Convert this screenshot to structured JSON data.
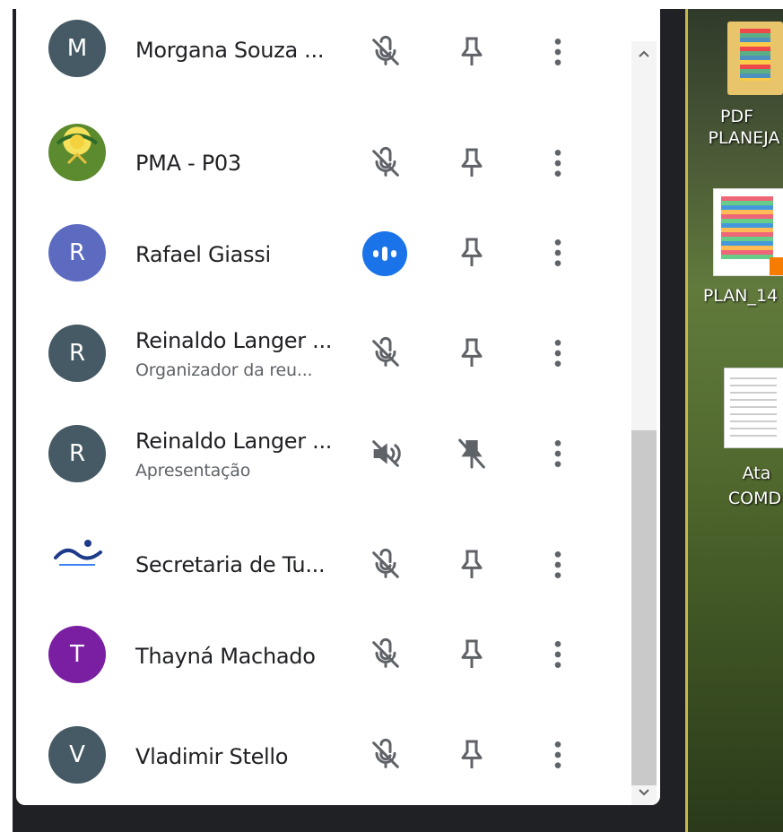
{
  "participants": [
    {
      "initial": "M",
      "name": "Morgana Souza ...",
      "subtitle": "",
      "avatar_color": "#455a64",
      "status": "muted"
    },
    {
      "initial": "",
      "name": "PMA - P03",
      "subtitle": "",
      "avatar_color": "#6f8f3a",
      "status": "muted"
    },
    {
      "initial": "R",
      "name": "Rafael Giassi",
      "subtitle": "",
      "avatar_color": "#5c6bc0",
      "status": "speaking"
    },
    {
      "initial": "R",
      "name": "Reinaldo Langer ...",
      "subtitle": "Organizador da reu...",
      "avatar_color": "#455a64",
      "status": "muted"
    },
    {
      "initial": "R",
      "name": "Reinaldo Langer ...",
      "subtitle": "Apresentação",
      "avatar_color": "#455a64",
      "status": "audio-off"
    },
    {
      "initial": "",
      "name": "Secretaria de Tu...",
      "subtitle": "",
      "avatar_color": "#ffffff",
      "status": "muted"
    },
    {
      "initial": "T",
      "name": "Thayná Machado",
      "subtitle": "",
      "avatar_color": "#7b1fa2",
      "status": "muted"
    },
    {
      "initial": "V",
      "name": "Vladimir Stello",
      "subtitle": "",
      "avatar_color": "#455a64",
      "status": "muted"
    }
  ],
  "desktop": {
    "items": [
      {
        "line1": "PDF",
        "line2": "PLANEJA"
      },
      {
        "line1": "PLAN_14",
        "line2": ""
      },
      {
        "line1": "Ata",
        "line2": "COMDE"
      }
    ]
  },
  "icons": {
    "mic": "mic-off-icon",
    "pin": "pin-icon",
    "more": "more-vert-icon",
    "speaking": "speaking-indicator-icon",
    "audio_off": "volume-off-icon",
    "pin_disabled": "pin-off-icon"
  },
  "colors": {
    "accent": "#1a73e8",
    "text": "#202124",
    "secondary_text": "#5f6368",
    "icon": "#5f6368"
  }
}
